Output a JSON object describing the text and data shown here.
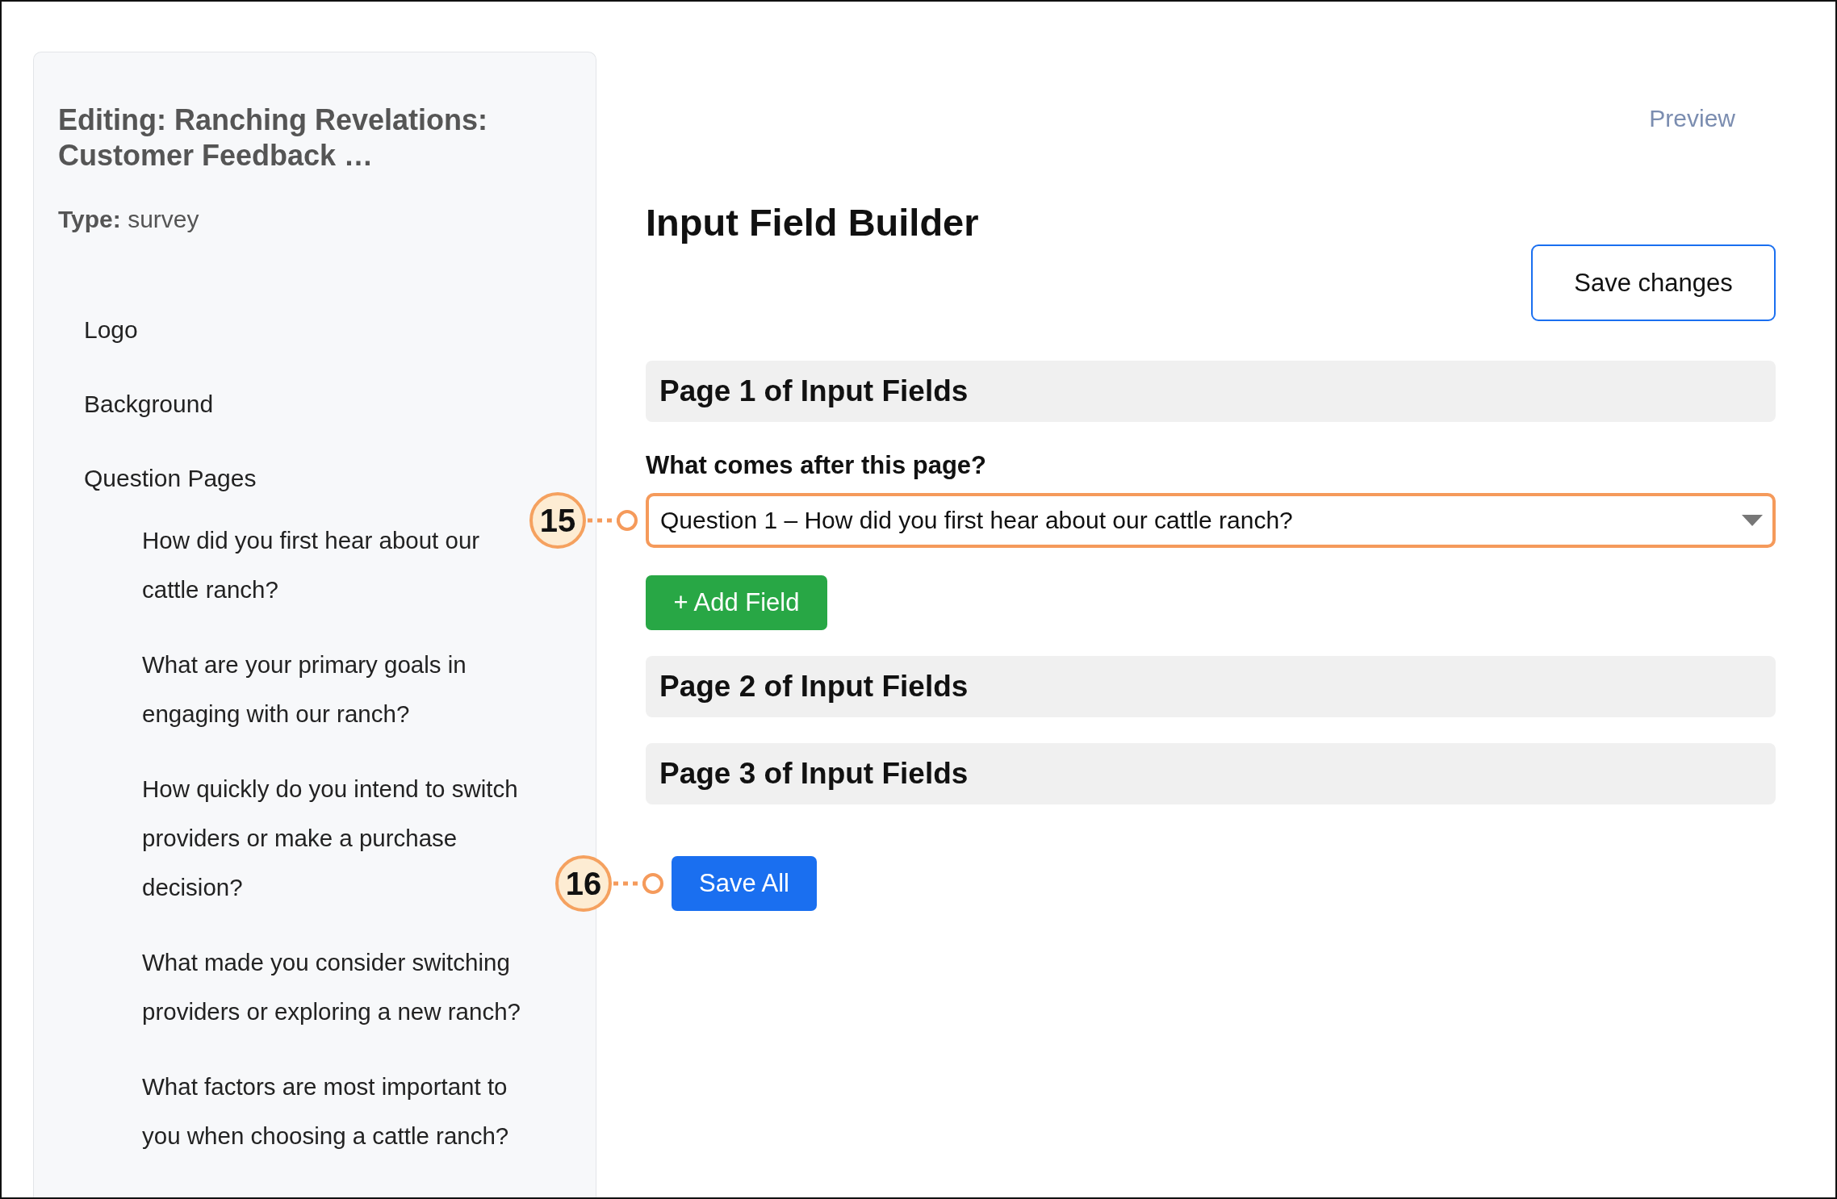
{
  "sidebar": {
    "title": "Editing: Ranching Revelations: Customer Feedback …",
    "type_label": "Type:",
    "type_value": "survey",
    "items": [
      {
        "label": "Logo"
      },
      {
        "label": "Background"
      },
      {
        "label": "Question Pages",
        "children": [
          {
            "label": "How did you first hear about our cattle ranch?"
          },
          {
            "label": "What are your primary goals in engaging with our ranch?"
          },
          {
            "label": "How quickly do you intend to switch providers or make a purchase decision?"
          },
          {
            "label": "What made you consider switching providers or exploring a new ranch?"
          },
          {
            "label": "What factors are most important to you when choosing a cattle ranch?"
          }
        ]
      }
    ]
  },
  "main": {
    "preview": "Preview",
    "heading": "Input Field Builder",
    "save_changes": "Save changes",
    "pages": [
      {
        "title": "Page 1 of Input Fields",
        "next_label": "What comes after this page?",
        "next_value": "Question 1 – How did you first hear about our cattle ranch?",
        "next_callout": "15",
        "add_field": "+ Add Field"
      },
      {
        "title": "Page 2 of Input Fields"
      },
      {
        "title": "Page 3 of Input Fields"
      }
    ],
    "save_all": "Save All",
    "save_all_callout": "16"
  }
}
